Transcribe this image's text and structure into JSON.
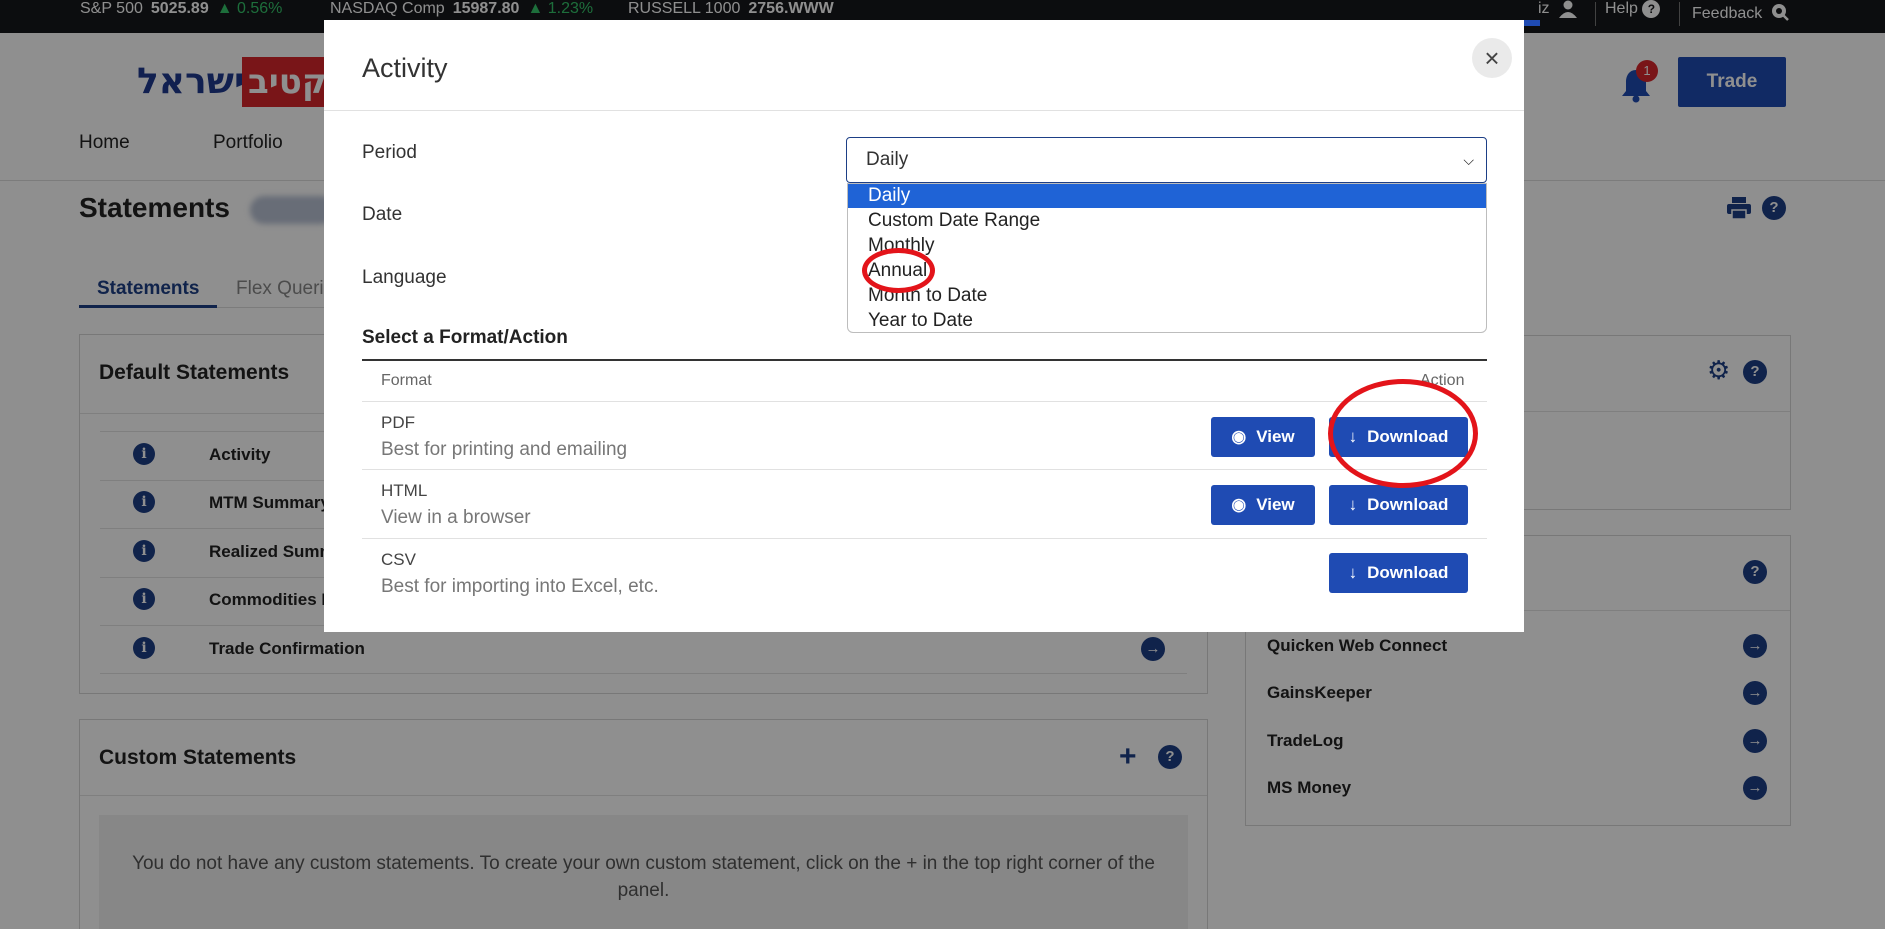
{
  "ticker": {
    "items": [
      {
        "name": "S&P 500",
        "value": "5025.89",
        "change": "▲ 0.56%"
      },
      {
        "name": "NASDAQ Comp",
        "value": "15987.80",
        "change": "▲ 1.23%"
      },
      {
        "name": "RUSSELL 1000",
        "value": "2756.WWW",
        "change": ""
      }
    ],
    "user_suffix": "iz",
    "help": "Help",
    "feedback": "Feedback"
  },
  "header": {
    "logo_hebrew": "ישראל",
    "logo_red": "קטיב",
    "nav": [
      "Home",
      "Portfolio"
    ],
    "notification_count": "1",
    "trade": "Trade"
  },
  "page": {
    "title": "Statements",
    "tabs": [
      "Statements",
      "Flex Queri"
    ]
  },
  "default_statements": {
    "title": "Default Statements",
    "rows": [
      "Activity",
      "MTM Summary",
      "Realized Summ",
      "Commodities R",
      "Trade Confirmation"
    ]
  },
  "custom_statements": {
    "title": "Custom Statements",
    "empty_text": "You do not have any custom statements. To create your own custom statement, click on the + in the top right corner of the panel."
  },
  "third_party": {
    "rows": [
      "Quicken Web Connect",
      "GainsKeeper",
      "TradeLog",
      "MS Money"
    ]
  },
  "modal": {
    "title": "Activity",
    "close": "×",
    "period_label": "Period",
    "date_label": "Date",
    "language_label": "Language",
    "period_value": "Daily",
    "period_options": [
      "Daily",
      "Custom Date Range",
      "Monthly",
      "Annual",
      "Month to Date",
      "Year to Date"
    ],
    "selected_option": "Daily",
    "section_title": "Select a Format/Action",
    "col_format": "Format",
    "col_action": "Action",
    "formats": [
      {
        "name": "PDF",
        "desc": "Best for printing and emailing",
        "view": "View",
        "download": "Download"
      },
      {
        "name": "HTML",
        "desc": "View in a browser",
        "view": "View",
        "download": "Download"
      },
      {
        "name": "CSV",
        "desc": "Best for importing into Excel, etc.",
        "download": "Download"
      }
    ]
  },
  "colors": {
    "primary": "#1f4bb3",
    "navy": "#1d3f86",
    "highlight": "#1f63d6",
    "annotation_red": "#e3141a"
  }
}
